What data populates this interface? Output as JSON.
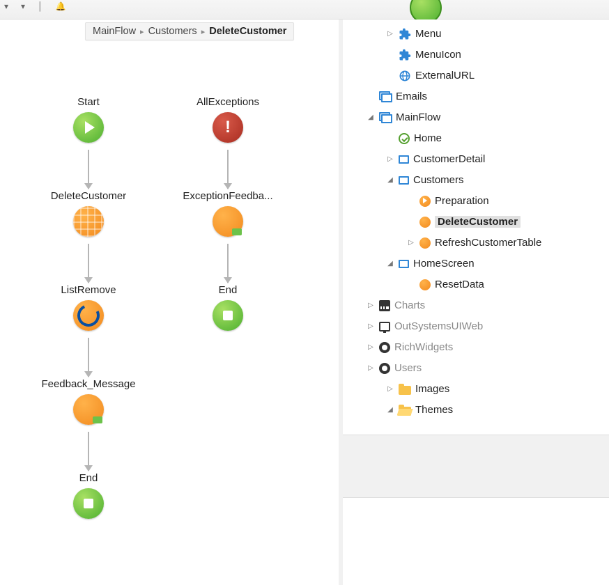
{
  "breadcrumb": {
    "items": [
      "MainFlow",
      "Customers",
      "DeleteCustomer"
    ],
    "current_index": 2
  },
  "flow": {
    "left_column": [
      {
        "label": "Start",
        "icon": "start"
      },
      {
        "label": "DeleteCustomer",
        "icon": "entity"
      },
      {
        "label": "ListRemove",
        "icon": "loop"
      },
      {
        "label": "Feedback_Message",
        "icon": "action"
      },
      {
        "label": "End",
        "icon": "end"
      }
    ],
    "right_column": [
      {
        "label": "AllExceptions",
        "icon": "error"
      },
      {
        "label": "ExceptionFeedba...",
        "icon": "action"
      },
      {
        "label": "End",
        "icon": "end"
      }
    ]
  },
  "tree": [
    {
      "depth": 3,
      "exp": "▷",
      "icon": "puzzle",
      "label": "Menu"
    },
    {
      "depth": 3,
      "exp": "",
      "icon": "puzzle",
      "label": "MenuIcon"
    },
    {
      "depth": 3,
      "exp": "",
      "icon": "globe",
      "label": "ExternalURL"
    },
    {
      "depth": 2,
      "exp": "",
      "icon": "screens",
      "label": "Emails"
    },
    {
      "depth": 2,
      "exp": "◢",
      "icon": "screens",
      "label": "MainFlow"
    },
    {
      "depth": 3,
      "exp": "",
      "icon": "check",
      "label": "Home"
    },
    {
      "depth": 3,
      "exp": "▷",
      "icon": "screen",
      "label": "CustomerDetail"
    },
    {
      "depth": 3,
      "exp": "◢",
      "icon": "screen",
      "label": "Customers"
    },
    {
      "depth": 4,
      "exp": "",
      "icon": "dot-play",
      "label": "Preparation"
    },
    {
      "depth": 4,
      "exp": "",
      "icon": "dot-orange",
      "label": "DeleteCustomer",
      "selected": true
    },
    {
      "depth": 4,
      "exp": "▷",
      "icon": "dot-orange",
      "label": "RefreshCustomerTable"
    },
    {
      "depth": 3,
      "exp": "◢",
      "icon": "screen",
      "label": "HomeScreen"
    },
    {
      "depth": 4,
      "exp": "",
      "icon": "dot-orange",
      "label": "ResetData"
    },
    {
      "depth": 2,
      "exp": "▷",
      "icon": "chart",
      "label": "Charts",
      "dim": true
    },
    {
      "depth": 2,
      "exp": "▷",
      "icon": "monitor",
      "label": "OutSystemsUIWeb",
      "dim": true
    },
    {
      "depth": 2,
      "exp": "▷",
      "icon": "ring",
      "label": "RichWidgets",
      "dim": true
    },
    {
      "depth": 2,
      "exp": "▷",
      "icon": "ring",
      "label": "Users",
      "dim": true
    },
    {
      "depth": 1,
      "exp": "▷",
      "icon": "folder",
      "label": "Images"
    },
    {
      "depth": 1,
      "exp": "◢",
      "icon": "folder-open",
      "label": "Themes"
    }
  ]
}
